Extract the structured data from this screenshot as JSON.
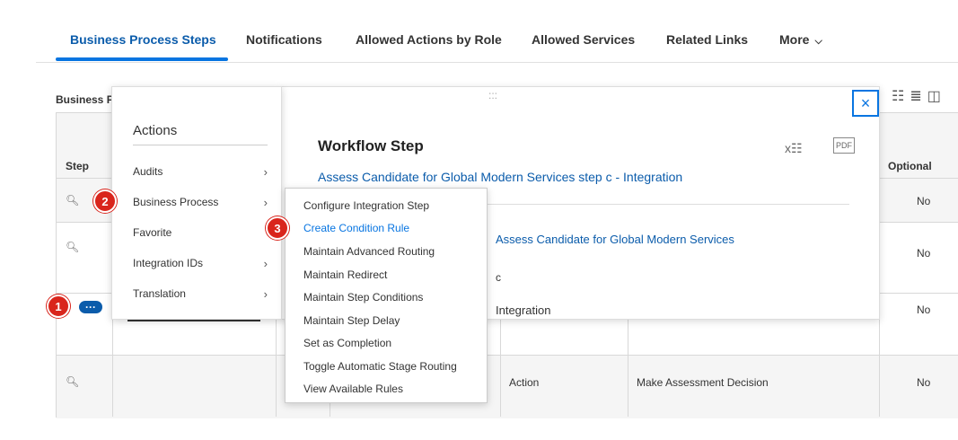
{
  "tabs": [
    {
      "label": "Business Process Steps",
      "active": true
    },
    {
      "label": "Notifications"
    },
    {
      "label": "Allowed Actions by Role"
    },
    {
      "label": "Allowed Services"
    },
    {
      "label": "Related Links"
    },
    {
      "label": "More"
    }
  ],
  "table": {
    "title": "Business Process Steps",
    "col_step": "Step",
    "col_optional": "Optional",
    "rows": [
      {
        "optional": "No"
      },
      {
        "optional": "No"
      },
      {
        "optional": "No"
      },
      {
        "type": "Action",
        "name": "Make Assessment Decision",
        "optional": "No"
      }
    ]
  },
  "actions_menu": {
    "title": "Actions",
    "items": [
      {
        "label": "Audits",
        "arrow": "›"
      },
      {
        "label": "Business Process",
        "arrow": "›"
      },
      {
        "label": "Favorite",
        "arrow": ""
      },
      {
        "label": "Integration IDs",
        "arrow": "›"
      },
      {
        "label": "Translation",
        "arrow": "›"
      }
    ]
  },
  "submenu": {
    "items": [
      "Configure Integration Step",
      "Create Condition Rule",
      "Maintain Advanced Routing",
      "Maintain Redirect",
      "Maintain Step Conditions",
      "Maintain Step Delay",
      "Set as Completion",
      "Toggle Automatic Stage Routing",
      "View Available Rules"
    ],
    "highlighted": "Create Condition Rule"
  },
  "popup": {
    "title": "Workflow Step",
    "subtitle": "Assess Candidate for Global Modern Services step c - Integration",
    "process_link": "Assess Candidate for Global Modern Services",
    "step_value": "c",
    "step_type": "Integration",
    "close_label": "×",
    "grip": ":::"
  },
  "badges": [
    "1",
    "2",
    "3"
  ],
  "more_button": "···",
  "colors": {
    "accent": "#0875e1",
    "link": "#0b5cab",
    "badge": "#d9251c"
  }
}
